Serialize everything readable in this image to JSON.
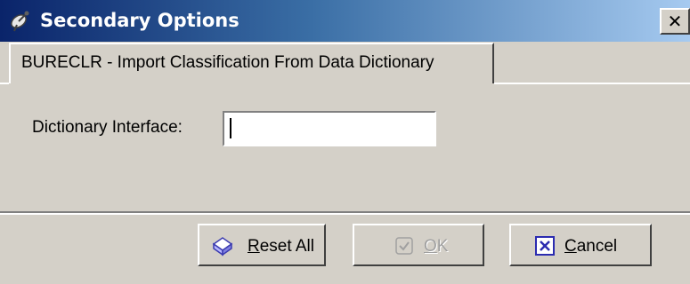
{
  "window": {
    "title": "Secondary Options",
    "close_glyph": "✕",
    "title_icon": "satellite-dish-icon"
  },
  "tab": {
    "label": "BURECLR - Import Classification From Data Dictionary"
  },
  "form": {
    "dictionary_interface_label": "Dictionary Interface:",
    "dictionary_interface_value": ""
  },
  "buttons": {
    "reset": {
      "mnemonic": "R",
      "rest": "eset All",
      "icon": "eraser-icon"
    },
    "ok": {
      "mnemonic": "O",
      "rest": "K",
      "icon": "check-icon",
      "enabled": false
    },
    "cancel": {
      "mnemonic": "C",
      "rest": "ancel",
      "icon": "x-box-icon"
    }
  }
}
